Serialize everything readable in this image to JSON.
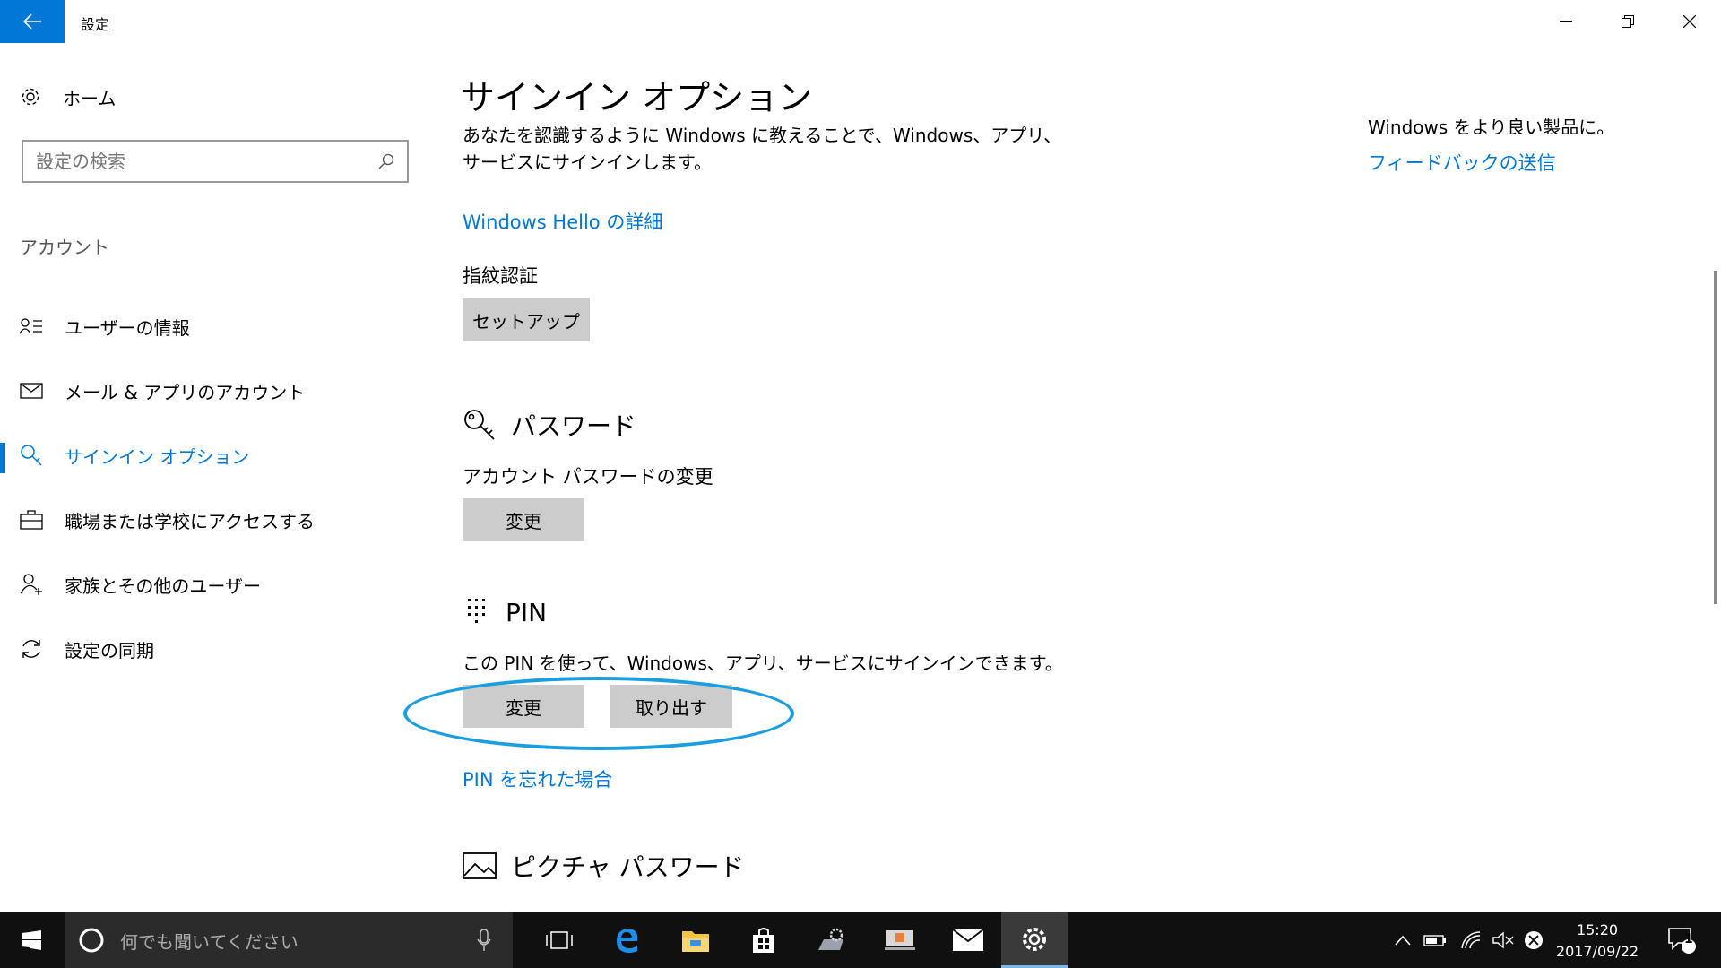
{
  "window": {
    "title": "設定"
  },
  "sidebar": {
    "home_label": "ホーム",
    "search_placeholder": "設定の検索",
    "section": "アカウント",
    "items": [
      {
        "label": "ユーザーの情報",
        "icon": "user-info-icon"
      },
      {
        "label": "メール & アプリのアカウント",
        "icon": "mail-icon"
      },
      {
        "label": "サインイン オプション",
        "icon": "key-icon",
        "active": true
      },
      {
        "label": "職場または学校にアクセスする",
        "icon": "briefcase-icon"
      },
      {
        "label": "家族とその他のユーザー",
        "icon": "add-user-icon"
      },
      {
        "label": "設定の同期",
        "icon": "sync-icon"
      }
    ]
  },
  "main": {
    "title": "サインイン オプション",
    "intro": "あなたを認識するように Windows に教えることで、Windows、アプリ、サービスにサインインします。",
    "hello_link": "Windows Hello の詳細",
    "fingerprint": {
      "label": "指紋認証",
      "button": "セットアップ"
    },
    "password": {
      "heading": "パスワード",
      "label": "アカウント パスワードの変更",
      "button": "変更"
    },
    "pin": {
      "heading": "PIN",
      "desc": "この PIN を使って、Windows、アプリ、サービスにサインインできます。",
      "change_button": "変更",
      "remove_button": "取り出す",
      "forgot_link": "PIN を忘れた場合"
    },
    "picture_password": {
      "heading": "ピクチャ パスワード"
    },
    "side": {
      "text": "Windows をより良い製品に。",
      "feedback_link": "フィードバックの送信"
    }
  },
  "taskbar": {
    "search_placeholder": "何でも聞いてください",
    "clock_time": "15:20",
    "clock_date": "2017/09/22",
    "notification_count": "1"
  },
  "colors": {
    "accent": "#0078d7",
    "button": "#cccccc",
    "highlight": "#1a9ee0",
    "taskbar": "#101010"
  }
}
